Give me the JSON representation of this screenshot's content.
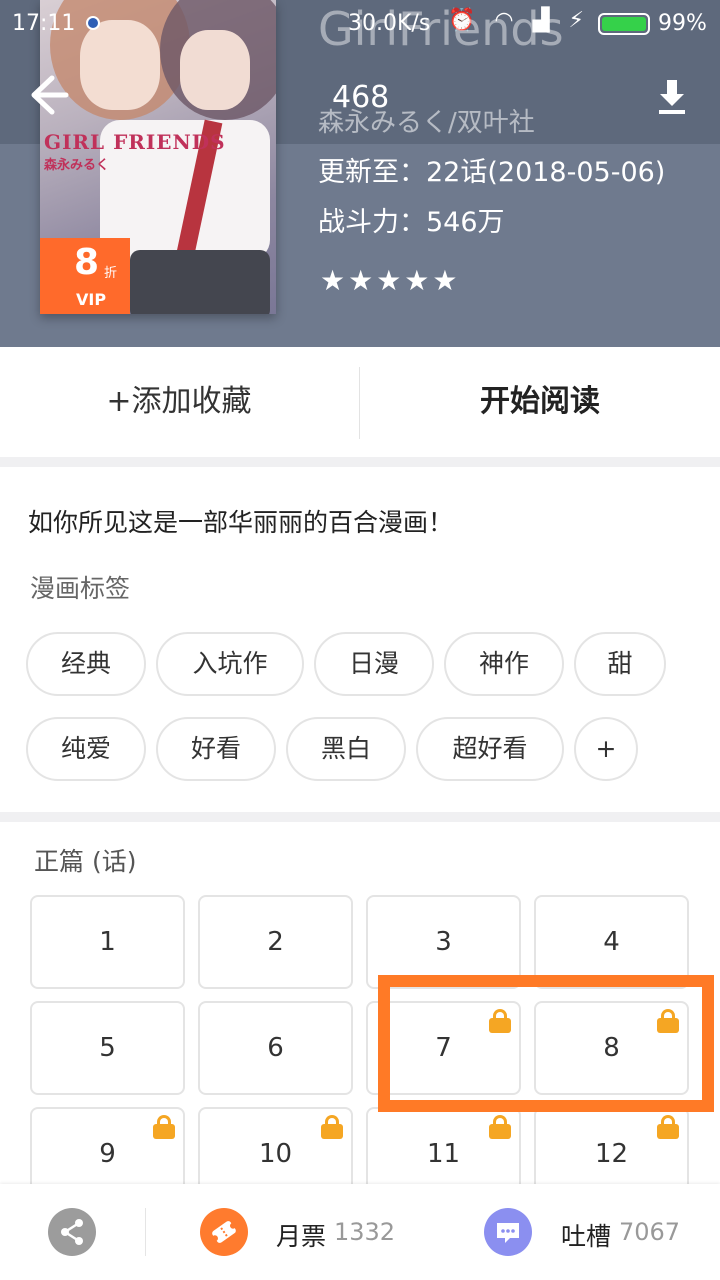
{
  "status_bar": {
    "time": "17:11",
    "speed": "30.0K/s",
    "battery": "99%"
  },
  "header": {
    "ghost_title": "GirlFriends",
    "count": "468",
    "author": "森永みるく/双叶社",
    "update": "更新至：22话(2018-05-06)",
    "power": "战斗力：546万",
    "stars": "★★★★★",
    "rating": 5,
    "cover": {
      "logo": "GIRL FRIENDS",
      "author": "森永みるく",
      "discount_num": "8",
      "discount_unit": "折",
      "discount_vip": "VIP"
    }
  },
  "actions": {
    "favorite": "+添加收藏",
    "read": "开始阅读"
  },
  "description": "如你所见这是一部华丽丽的百合漫画！",
  "tags_title": "漫画标签",
  "tags": [
    "经典",
    "入坑作",
    "日漫",
    "神作",
    "甜",
    "纯爱",
    "好看",
    "黑白",
    "超好看",
    "+"
  ],
  "chapters_title": "正篇 (话)",
  "chapters": [
    {
      "label": "1",
      "locked": false
    },
    {
      "label": "2",
      "locked": false
    },
    {
      "label": "3",
      "locked": false
    },
    {
      "label": "4",
      "locked": false
    },
    {
      "label": "5",
      "locked": false
    },
    {
      "label": "6",
      "locked": false
    },
    {
      "label": "7",
      "locked": true
    },
    {
      "label": "8",
      "locked": true
    },
    {
      "label": "9",
      "locked": true
    },
    {
      "label": "10",
      "locked": true
    },
    {
      "label": "11",
      "locked": true
    },
    {
      "label": "12",
      "locked": true
    }
  ],
  "bottom_bar": {
    "ticket_label": "月票",
    "ticket_count": "1332",
    "comment_label": "吐槽",
    "comment_count": "7067"
  },
  "colors": {
    "header_bg": "#6f7a8e",
    "accent": "#ff7a26",
    "lock": "#f5a623",
    "ticket": "#ff7b2e",
    "chat": "#8b8ff0"
  },
  "icons": [
    "back-arrow-icon",
    "download-icon",
    "lock-icon",
    "share-icon",
    "ticket-icon",
    "chat-icon"
  ]
}
